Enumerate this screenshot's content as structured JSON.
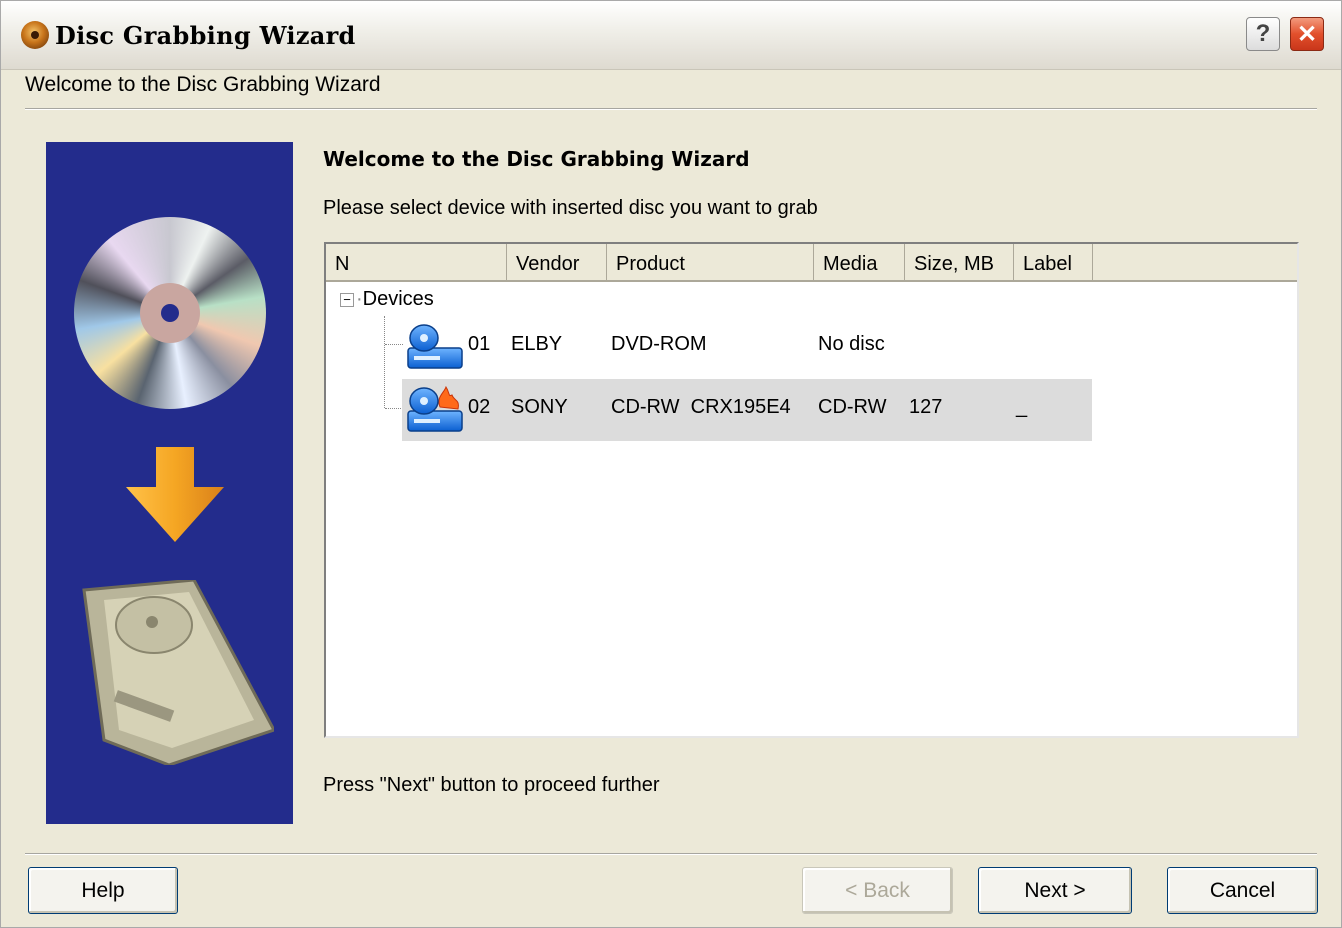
{
  "window": {
    "title": "Disc Grabbing Wizard",
    "subtitle": "Welcome to the Disc Grabbing Wizard",
    "help_glyph": "?",
    "close_glyph": "✕"
  },
  "content": {
    "heading": "Welcome to the Disc Grabbing Wizard",
    "instruction": "Please select device with inserted disc you want to grab",
    "footer_note": "Press \"Next\" button to proceed further"
  },
  "device_list": {
    "columns": [
      "N",
      "Vendor",
      "Product",
      "Media",
      "Size, MB",
      "Label"
    ],
    "root_label": "Devices",
    "root_expander": "−",
    "rows": [
      {
        "n": "01",
        "vendor": "ELBY",
        "product": "DVD-ROM",
        "media": "No disc",
        "size": "",
        "label": "",
        "selected": false,
        "icon": "dvd-drive-icon"
      },
      {
        "n": "02",
        "vendor": "SONY",
        "product": "CD-RW  CRX195E4",
        "media": "CD-RW",
        "size": "127",
        "label": "_",
        "selected": true,
        "icon": "cd-burner-icon"
      }
    ]
  },
  "buttons": {
    "help": "Help",
    "back": "< Back",
    "next": "Next >",
    "cancel": "Cancel"
  },
  "colors": {
    "sidebar": "#232c8c",
    "arrow": "#f5a623",
    "selection": "#dcdcdc"
  }
}
